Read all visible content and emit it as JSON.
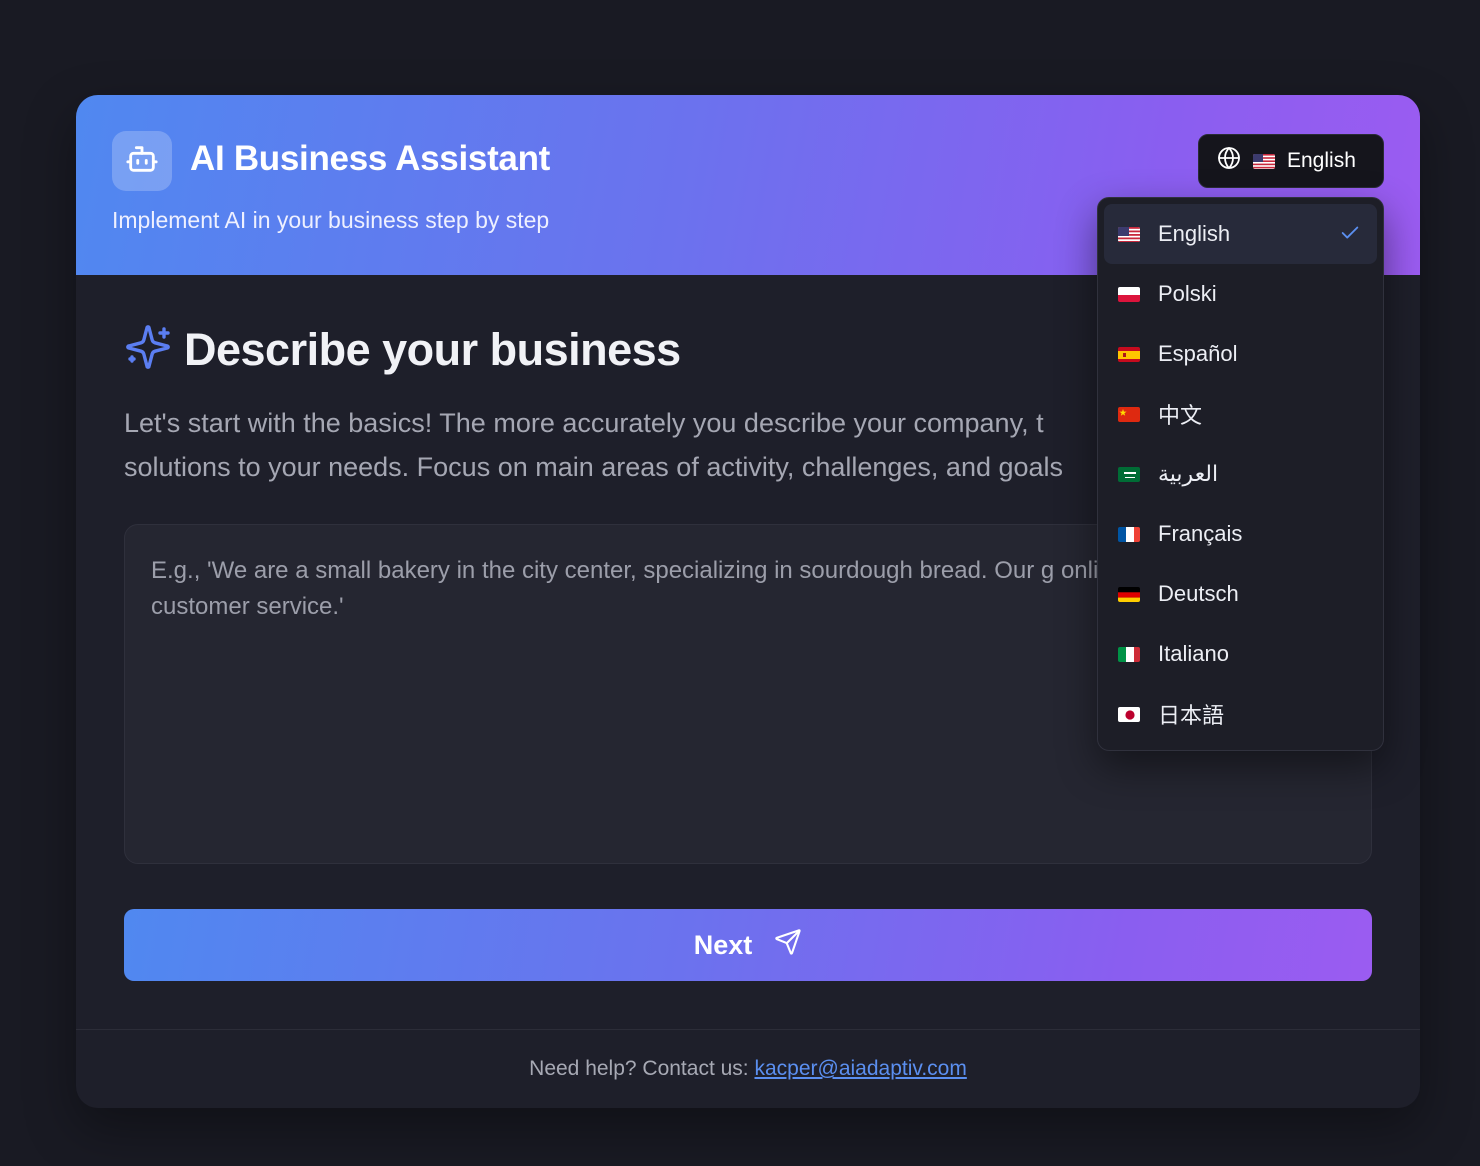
{
  "header": {
    "title": "AI Business Assistant",
    "subtitle": "Implement AI in your business step by step",
    "logo_icon": "robot-icon"
  },
  "language_selector": {
    "current_label": "English",
    "current_flag": "us",
    "icon": "globe-icon"
  },
  "language_menu": {
    "items": [
      {
        "label": "English",
        "flag": "us",
        "selected": true
      },
      {
        "label": "Polski",
        "flag": "pl",
        "selected": false
      },
      {
        "label": "Español",
        "flag": "es",
        "selected": false
      },
      {
        "label": "中文",
        "flag": "cn",
        "selected": false
      },
      {
        "label": "العربية",
        "flag": "sa",
        "selected": false
      },
      {
        "label": "Français",
        "flag": "fr",
        "selected": false
      },
      {
        "label": "Deutsch",
        "flag": "de",
        "selected": false
      },
      {
        "label": "Italiano",
        "flag": "it",
        "selected": false
      },
      {
        "label": "日本語",
        "flag": "jp",
        "selected": false
      }
    ]
  },
  "main": {
    "title": "Describe your business",
    "title_icon": "sparkles-icon",
    "intro_line1": "Let's start with the basics! The more accurately you describe your company, t",
    "intro_line2": "solutions to your needs. Focus on main areas of activity, challenges, and goals",
    "textarea_placeholder": "E.g., 'We are a small bakery in the city center, specializing in sourdough bread. Our g online sales and improve customer service.'",
    "next_label": "Next",
    "next_icon": "send-icon"
  },
  "footer": {
    "help_text": "Need help? Contact us:",
    "email": "kacper@aiadaptiv.com"
  },
  "colors": {
    "background": "#191a23",
    "card": "#1e1f2a",
    "gradient_start": "#5088f0",
    "gradient_end": "#9b5cf1",
    "accent": "#5b8ff0"
  }
}
